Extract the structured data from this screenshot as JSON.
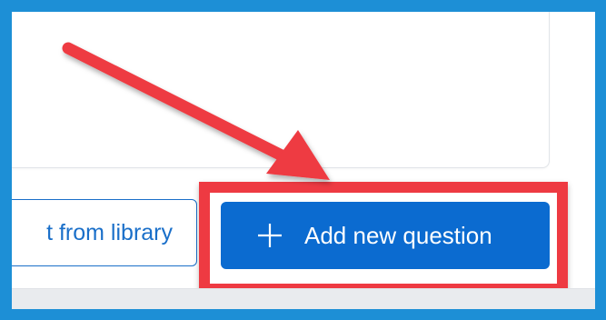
{
  "footer": {
    "library_button_label": "t from library",
    "add_button_label": "Add new question"
  },
  "icons": {
    "add": "plus-icon"
  },
  "colors": {
    "frame_border": "#1d8fd6",
    "highlight": "#ee3a42",
    "primary_button": "#0b6bd0",
    "primary_text": "#1a6fc9",
    "arrow": "#ee3a42"
  }
}
